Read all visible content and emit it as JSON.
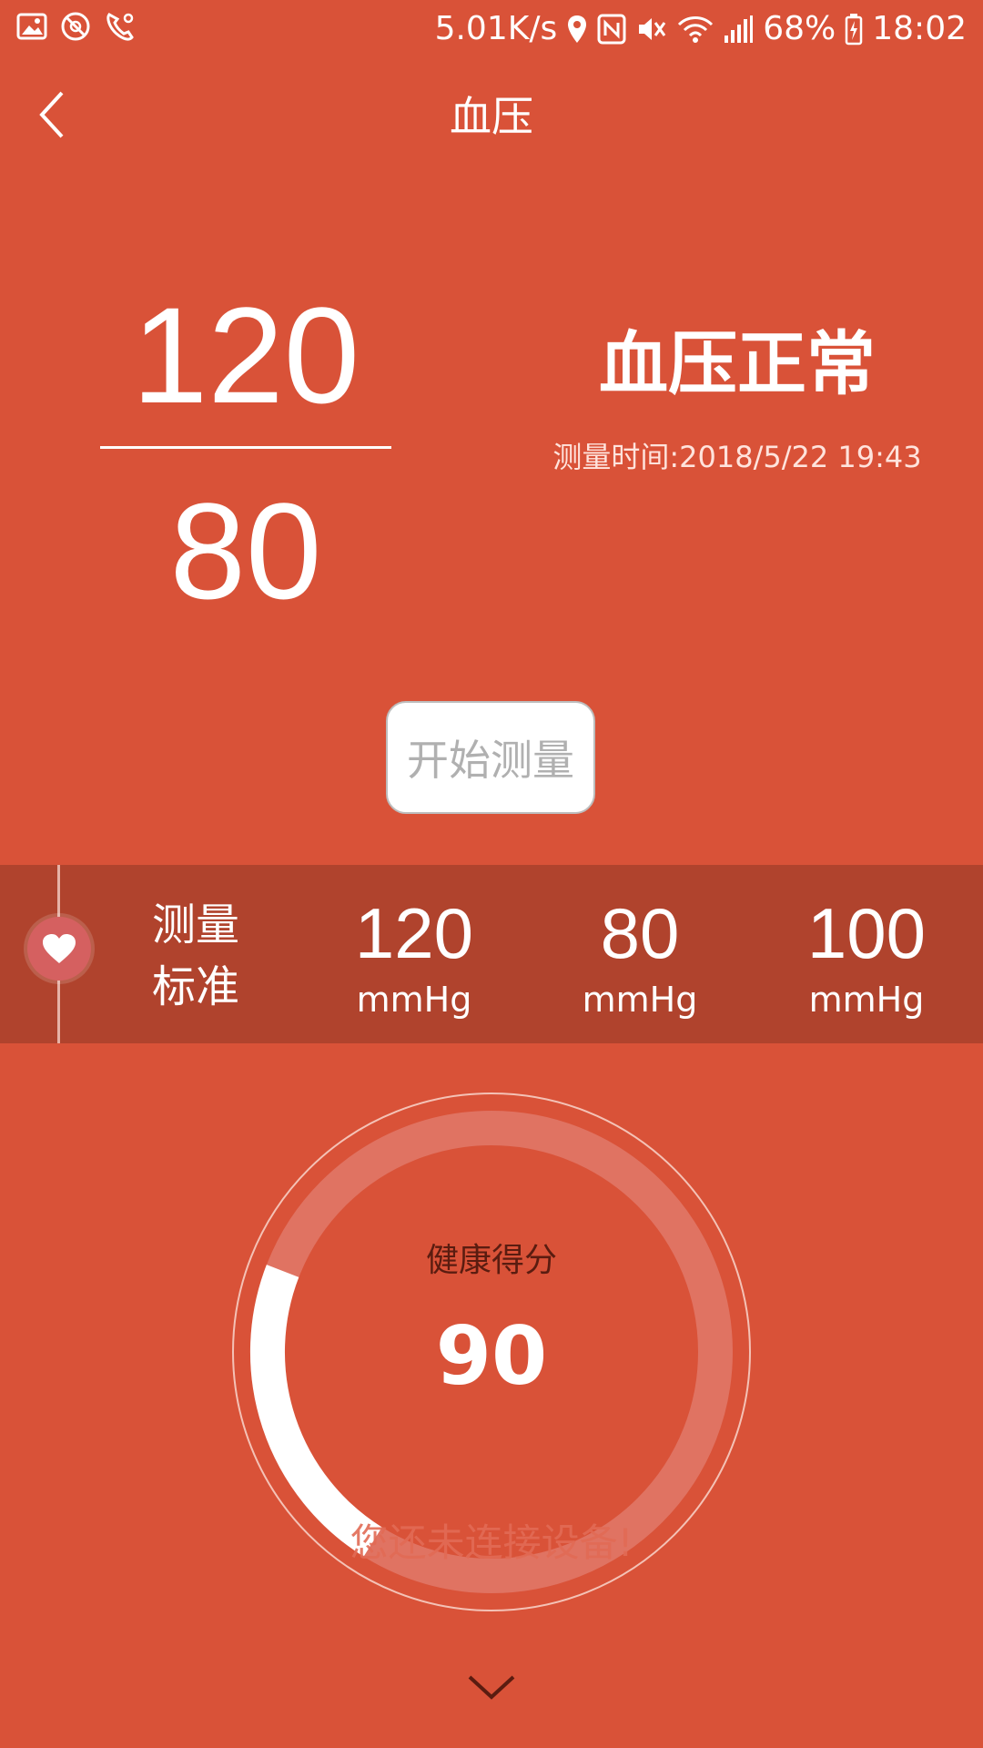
{
  "status_bar": {
    "net_speed": "5.01K/s",
    "battery": "68%",
    "time": "18:02"
  },
  "header": {
    "title": "血压"
  },
  "reading": {
    "systolic": "120",
    "diastolic": "80",
    "status": "血压正常",
    "measure_time": "测量时间:2018/5/22 19:43"
  },
  "start_button": {
    "label": "开始测量"
  },
  "standard": {
    "label_line1": "测量",
    "label_line2": "标准",
    "items": [
      {
        "value": "120",
        "unit": "mmHg"
      },
      {
        "value": "80",
        "unit": "mmHg"
      },
      {
        "value": "100",
        "unit": "mmHg"
      }
    ]
  },
  "score": {
    "label": "健康得分",
    "value": "90",
    "ring_progress": 0.22
  },
  "toast": {
    "message": "您还未连接设备!"
  },
  "colors": {
    "background": "#D95238",
    "band": "#B0432D",
    "ring_track": "#E07362"
  }
}
